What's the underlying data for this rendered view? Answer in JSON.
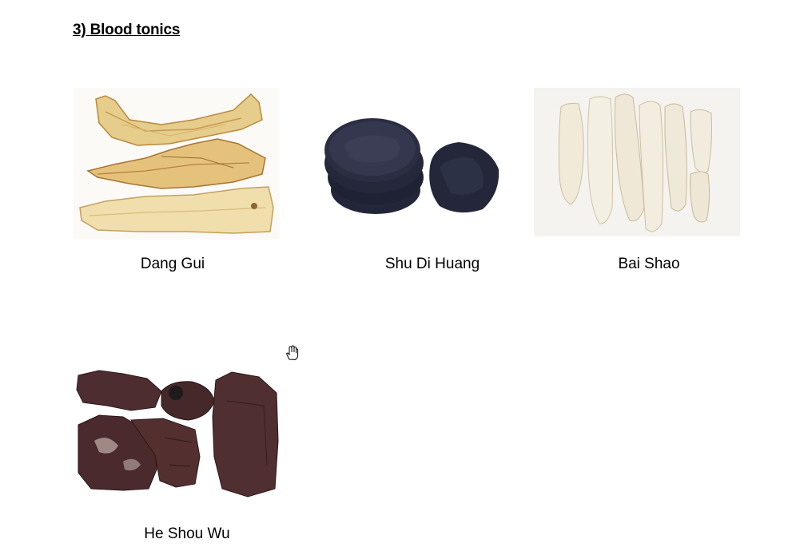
{
  "heading": "3) Blood tonics",
  "herbs": [
    {
      "name": "Dang Gui",
      "image": "dang-gui-image"
    },
    {
      "name": "Shu Di Huang",
      "image": "shu-di-huang-image"
    },
    {
      "name": "Bai Shao",
      "image": "bai-shao-image"
    },
    {
      "name": "He Shou Wu",
      "image": "he-shou-wu-image"
    }
  ],
  "cursor": "hand-cursor-icon",
  "colors": {
    "dang_gui": "#e8cf8f",
    "shu_di_huang": "#1c1f2e",
    "bai_shao": "#f2ece0",
    "he_shou_wu": "#4a2a2c"
  }
}
